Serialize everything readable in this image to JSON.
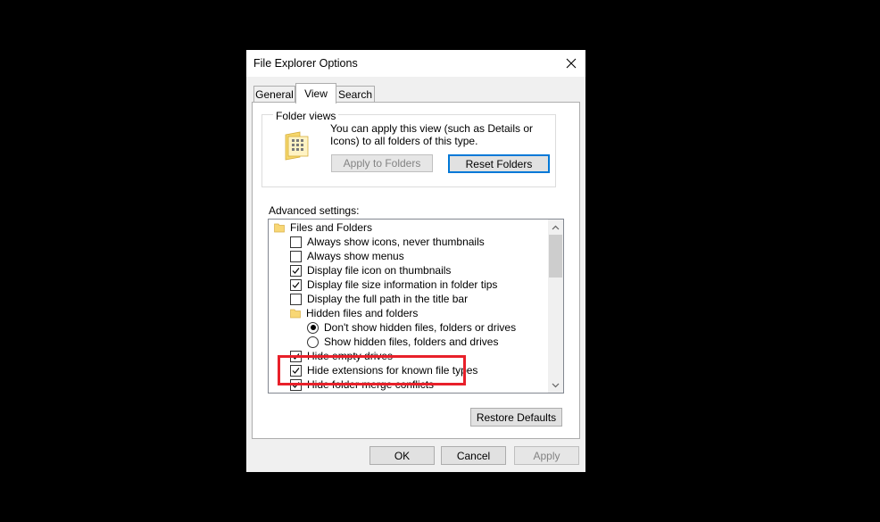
{
  "dialog": {
    "title": "File Explorer Options",
    "close_icon": "close-icon"
  },
  "tabs": [
    {
      "label": "General"
    },
    {
      "label": "View",
      "active": true
    },
    {
      "label": "Search"
    }
  ],
  "folder_views": {
    "legend": "Folder views",
    "description": "You can apply this view (such as Details or Icons) to all folders of this type.",
    "apply_button": "Apply to Folders",
    "reset_button": "Reset Folders",
    "icon": "folder-view-icon"
  },
  "advanced": {
    "label": "Advanced settings:",
    "items": [
      {
        "type": "folder",
        "label": "Files and Folders"
      },
      {
        "type": "checkbox",
        "label": "Always show icons, never thumbnails",
        "checked": false
      },
      {
        "type": "checkbox",
        "label": "Always show menus",
        "checked": false
      },
      {
        "type": "checkbox",
        "label": "Display file icon on thumbnails",
        "checked": true
      },
      {
        "type": "checkbox",
        "label": "Display file size information in folder tips",
        "checked": true
      },
      {
        "type": "checkbox",
        "label": "Display the full path in the title bar",
        "checked": false
      },
      {
        "type": "folder",
        "label": "Hidden files and folders"
      },
      {
        "type": "radio",
        "label": "Don't show hidden files, folders or drives",
        "checked": true
      },
      {
        "type": "radio",
        "label": "Show hidden files, folders and drives",
        "checked": false
      },
      {
        "type": "checkbox",
        "label": "Hide empty drives",
        "checked": true
      },
      {
        "type": "checkbox",
        "label": "Hide extensions for known file types",
        "checked": true
      },
      {
        "type": "checkbox",
        "label": "Hide folder merge conflicts",
        "checked": true
      }
    ]
  },
  "restore_defaults": "Restore Defaults",
  "footer": {
    "ok": "OK",
    "cancel": "Cancel",
    "apply": "Apply"
  },
  "colors": {
    "highlight": "#e8202a",
    "accent": "#0078d7"
  }
}
